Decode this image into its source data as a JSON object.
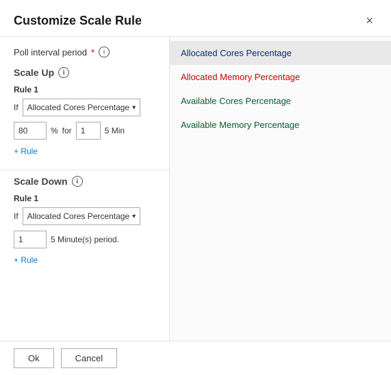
{
  "dialog": {
    "title": "Customize Scale Rule",
    "close_label": "×"
  },
  "left_panel": {
    "poll_interval": {
      "label": "Poll interval period",
      "required": true,
      "info": "i"
    },
    "scale_up": {
      "section_title": "Scale Up",
      "info": "i",
      "rule1": {
        "label": "Rule 1",
        "if_label": "If",
        "dropdown_value": "Allocated Cores Percentage",
        "chevron": "▾",
        "value": "80",
        "percent": "%",
        "for_label": "for",
        "time_value": "1",
        "time_unit": "5 Min"
      },
      "add_rule_label": "+ Rule"
    },
    "scale_down": {
      "section_title": "Scale Down",
      "info": "i",
      "rule1": {
        "label": "Rule 1",
        "if_label": "If",
        "dropdown_value": "Allocated Cores Percentage",
        "chevron": "▾",
        "value": "1",
        "period_text": "5 Minute(s) period."
      },
      "add_rule_label": "+ Rule"
    }
  },
  "right_panel": {
    "items": [
      {
        "id": "allocated-cores",
        "label": "Allocated Cores Percentage",
        "selected": true,
        "color_class": "blue"
      },
      {
        "id": "allocated-memory",
        "label": "Allocated Memory Percentage",
        "selected": false,
        "color_class": "memory"
      },
      {
        "id": "available-cores",
        "label": "Available Cores Percentage",
        "selected": false,
        "color_class": "available-cores"
      },
      {
        "id": "available-memory",
        "label": "Available Memory Percentage",
        "selected": false,
        "color_class": "available-memory"
      }
    ]
  },
  "footer": {
    "ok_label": "Ok",
    "cancel_label": "Cancel"
  }
}
